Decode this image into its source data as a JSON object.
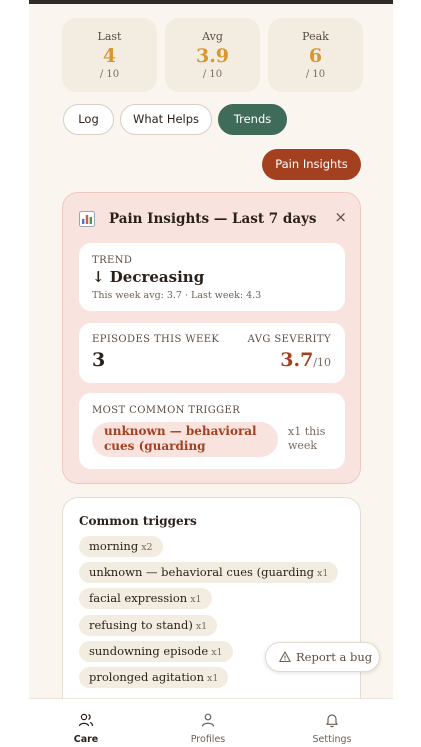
{
  "stats": [
    {
      "label": "Last",
      "value": "4",
      "denom": "/ 10"
    },
    {
      "label": "Avg",
      "value": "3.9",
      "denom": "/ 10"
    },
    {
      "label": "Peak",
      "value": "6",
      "denom": "/ 10"
    }
  ],
  "tabs": [
    {
      "label": "Log"
    },
    {
      "label": "What Helps"
    },
    {
      "label": "Trends",
      "active": true
    }
  ],
  "pain_insights_button": "Pain Insights",
  "insights_panel": {
    "icon": "bar-chart-icon",
    "title": "Pain Insights — Last 7 days",
    "close_label": "×",
    "trend": {
      "caption": "TREND",
      "value": "↓ Decreasing",
      "subtext": "This week avg: 3.7 · Last week: 4.3"
    },
    "episodes": {
      "caption": "EPISODES THIS WEEK",
      "value": "3",
      "severity_caption": "AVG SEVERITY",
      "severity_value": "3.7",
      "severity_denom": "/10"
    },
    "trigger": {
      "caption": "MOST COMMON TRIGGER",
      "value_line1": "unknown — behavioral",
      "value_line2": "cues (guarding",
      "count_line1": "x1 this",
      "count_line2": "week"
    }
  },
  "common_triggers": {
    "title": "Common triggers",
    "items": [
      {
        "label": "morning",
        "count": "x2"
      },
      {
        "label": "unknown — behavioral cues (guarding",
        "count": "x1"
      },
      {
        "label": "facial expression",
        "count": "x1"
      },
      {
        "label": "refusing to stand)",
        "count": "x1"
      },
      {
        "label": "sundowning episode",
        "count": "x1"
      },
      {
        "label": "prolonged agitation",
        "count": "x1"
      }
    ]
  },
  "report_bug": {
    "icon": "warning-triangle-icon",
    "label": "Report a bug"
  },
  "bottom_nav": [
    {
      "label": "Care",
      "icon": "users-icon",
      "active": true
    },
    {
      "label": "Profiles",
      "icon": "user-icon",
      "active": false
    },
    {
      "label": "Settings",
      "icon": "bell-icon",
      "active": false
    }
  ],
  "colors": {
    "accent_green": "#3f6b5b",
    "accent_rust": "#a2401f",
    "stat_orange": "#d9962f",
    "panel_pink": "#f9e3df"
  }
}
